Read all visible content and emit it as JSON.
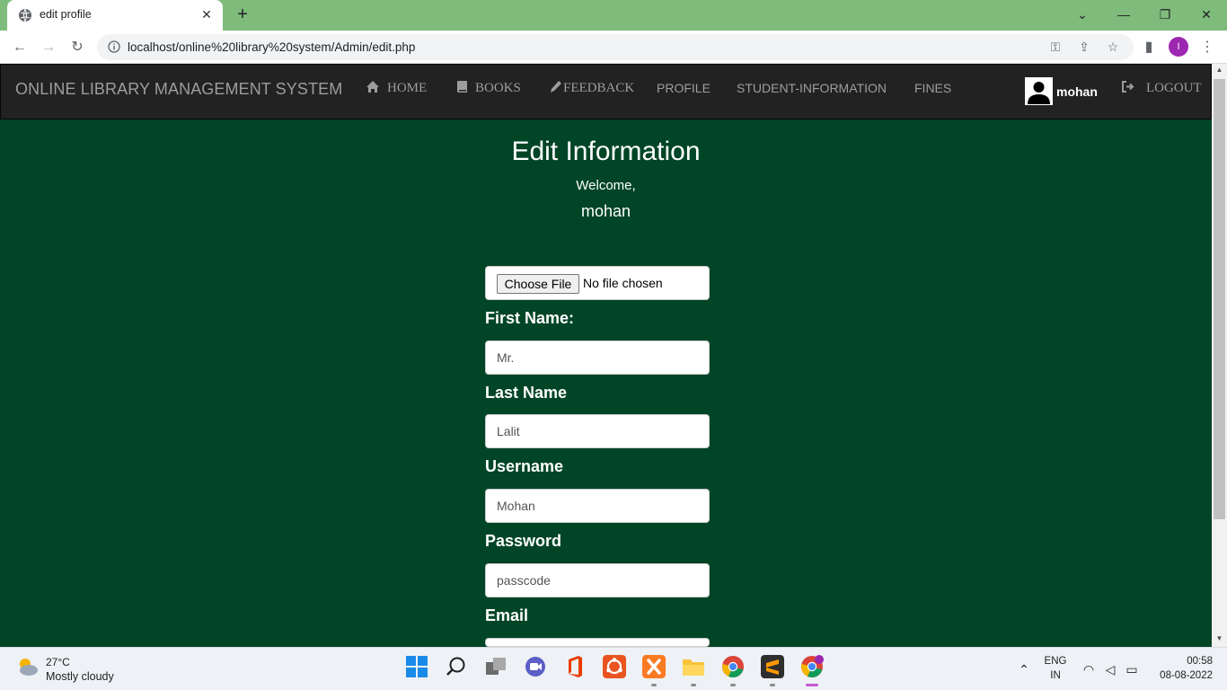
{
  "browser": {
    "tab_title": "edit profile",
    "url": "localhost/online%20library%20system/Admin/edit.php",
    "profile_initial": "I",
    "colors": {
      "tab_strip": "#7fbb7b",
      "profile": "#9c27b0"
    }
  },
  "navbar": {
    "brand": "ONLINE LIBRARY MANAGEMENT SYSTEM",
    "items": [
      {
        "label": "HOME",
        "icon": "home-icon"
      },
      {
        "label": "BOOKS",
        "icon": "book-icon"
      },
      {
        "label": "FEEDBACK",
        "icon": "pencil-icon"
      },
      {
        "label": "PROFILE"
      },
      {
        "label": "STUDENT-INFORMATION"
      },
      {
        "label": "FINES"
      }
    ],
    "user": "mohan",
    "logout": {
      "label": "LOGOUT",
      "icon": "logout-icon"
    },
    "colors": {
      "background": "#222222",
      "text": "#9d9d9d"
    }
  },
  "main": {
    "title": "Edit Information",
    "welcome": "Welcome,",
    "username": "mohan",
    "file": {
      "button": "Choose File",
      "status": "No file chosen"
    },
    "fields": [
      {
        "label": "First Name:",
        "value": "Mr."
      },
      {
        "label": "Last Name",
        "value": "Lalit"
      },
      {
        "label": "Username",
        "value": "Mohan"
      },
      {
        "label": "Password",
        "value": "passcode"
      },
      {
        "label": "Email",
        "value": ""
      }
    ],
    "colors": {
      "background": "#004526"
    }
  },
  "taskbar": {
    "temperature": "27°C",
    "weather": "Mostly cloudy",
    "language": "ENG",
    "region": "IN",
    "time": "00:58",
    "date": "08-08-2022"
  }
}
